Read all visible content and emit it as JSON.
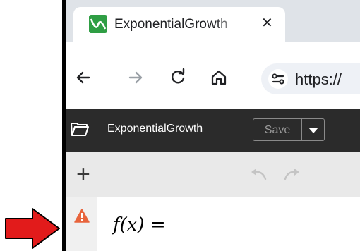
{
  "tab": {
    "title": "ExponentialGrowth",
    "close_glyph": "✕"
  },
  "toolbar": {
    "url": "https://",
    "back": "back-icon",
    "forward": "forward-icon",
    "reload": "reload-icon",
    "home": "home-icon"
  },
  "app": {
    "document_title": "ExponentialGrowth",
    "save_label": "Save"
  },
  "exprbar": {
    "add_glyph": "+"
  },
  "expressions": [
    {
      "latex": "f(x) =",
      "status": "warning"
    }
  ],
  "colors": {
    "appbar": "#2b2b2b",
    "warning": "#e8643c",
    "pointer_arrow": "#e21b1b"
  }
}
